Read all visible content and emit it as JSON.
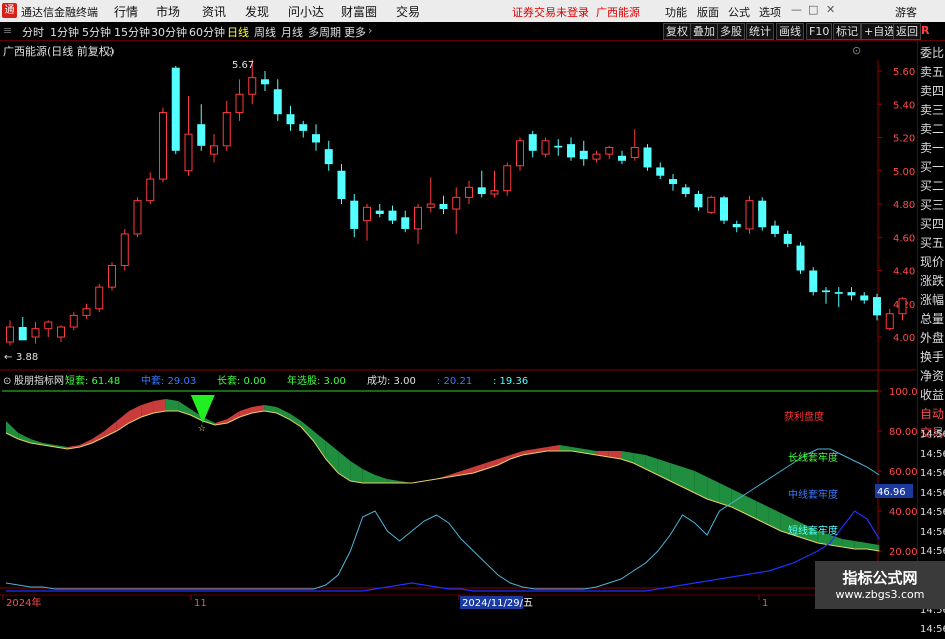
{
  "app": {
    "logo_glyph": "通",
    "title": "通达信金融终端"
  },
  "menu": [
    "行情",
    "市场",
    "资讯",
    "发现",
    "问小达",
    "财富圈",
    "交易"
  ],
  "notice": {
    "left": "证券交易未登录",
    "right": "广西能源"
  },
  "right_menu": [
    "功能",
    "版面",
    "公式",
    "选项",
    "游客"
  ],
  "periods": [
    {
      "label": "分时",
      "active": false
    },
    {
      "label": "1分钟",
      "active": false
    },
    {
      "label": "5分钟",
      "active": false
    },
    {
      "label": "15分钟",
      "active": false
    },
    {
      "label": "30分钟",
      "active": false
    },
    {
      "label": "60分钟",
      "active": false
    },
    {
      "label": "日线",
      "active": true
    },
    {
      "label": "周线",
      "active": false
    },
    {
      "label": "月线",
      "active": false
    },
    {
      "label": "多周期",
      "active": false
    },
    {
      "label": "更多",
      "active": false
    }
  ],
  "tools": [
    "复权",
    "叠加",
    "多股",
    "统计",
    "画线",
    "F10",
    "标记",
    "+自选",
    "返回"
  ],
  "sidebar": {
    "r_label": "R",
    "items": [
      "委比",
      "卖五",
      "卖四",
      "卖三",
      "卖二",
      "卖一",
      "买一",
      "买二",
      "买三",
      "买四",
      "买五",
      "现价",
      "涨跌",
      "涨幅",
      "总量",
      "外盘",
      "换手",
      "净资",
      "收益",
      "自动",
      "交易"
    ]
  },
  "colors": {
    "up": "#ff3b3b",
    "down": "#54ffff",
    "bg": "#000000",
    "grid": "#550000"
  },
  "main_chart": {
    "title": "广西能源(日线 前复权)",
    "high_label": "5.67",
    "low_label": "3.88",
    "ylim": [
      3.9,
      5.7
    ],
    "y_ticks": [
      "5.60",
      "5.40",
      "5.20",
      "5.00",
      "4.80",
      "4.60",
      "4.40",
      "4.20",
      "4.00"
    ]
  },
  "indicator": {
    "name": "股朋指标网",
    "items": [
      {
        "label": "短套:",
        "value": "61.48",
        "color": "#40ff40"
      },
      {
        "label": "中套:",
        "value": "29.03",
        "color": "#3a7bff"
      },
      {
        "label": "长套:",
        "value": "0.00",
        "color": "#40ff40"
      },
      {
        "label": "年选股:",
        "value": "3.00",
        "color": "#40ff40"
      },
      {
        "label": "成功:",
        "value": "3.00",
        "color": "#e0e0e0"
      },
      {
        "label": ":",
        "value": "20.21",
        "color": "#3a7bff"
      },
      {
        "label": ":",
        "value": "19.36",
        "color": "#54ffff"
      }
    ],
    "y_ticks": [
      "100.0",
      "80.00",
      "60.00",
      "40.00",
      "20.00"
    ],
    "current_value": "46.96",
    "annotations": {
      "profit": "获利盘度",
      "long": "长线套牢度",
      "mid": "中线套牢度",
      "short": "短线套牢度"
    },
    "right_times": [
      "14:56",
      "14:56",
      "14:56",
      "14:56",
      "14:56",
      "14:56",
      "14:56",
      "14:56",
      "14:56",
      "14:56",
      "14:56"
    ]
  },
  "x_axis": {
    "labels": [
      "2024年",
      "11",
      "2024/11/29/五",
      "1"
    ]
  },
  "watermark": {
    "line1": "指标公式网",
    "line2": "www.zbgs3.com"
  },
  "chart_data": {
    "type": "candlestick",
    "ohlc": [
      [
        3.97,
        4.1,
        3.95,
        4.06
      ],
      [
        4.06,
        4.12,
        4.02,
        3.98
      ],
      [
        4.0,
        4.09,
        3.96,
        4.05
      ],
      [
        4.05,
        4.1,
        4.0,
        4.09
      ],
      [
        4.0,
        4.07,
        3.97,
        4.06
      ],
      [
        4.06,
        4.15,
        4.04,
        4.13
      ],
      [
        4.13,
        4.2,
        4.11,
        4.17
      ],
      [
        4.17,
        4.32,
        4.15,
        4.3
      ],
      [
        4.3,
        4.45,
        4.28,
        4.43
      ],
      [
        4.43,
        4.65,
        4.4,
        4.62
      ],
      [
        4.62,
        4.84,
        4.6,
        4.82
      ],
      [
        4.82,
        4.99,
        4.8,
        4.95
      ],
      [
        4.95,
        5.38,
        4.93,
        5.35
      ],
      [
        5.62,
        5.63,
        5.1,
        5.12
      ],
      [
        5.0,
        5.45,
        4.97,
        5.22
      ],
      [
        5.28,
        5.4,
        5.12,
        5.15
      ],
      [
        5.1,
        5.22,
        5.05,
        5.15
      ],
      [
        5.15,
        5.42,
        5.12,
        5.35
      ],
      [
        5.35,
        5.55,
        5.3,
        5.46
      ],
      [
        5.46,
        5.67,
        5.4,
        5.56
      ],
      [
        5.55,
        5.6,
        5.48,
        5.52
      ],
      [
        5.49,
        5.55,
        5.3,
        5.34
      ],
      [
        5.34,
        5.39,
        5.24,
        5.28
      ],
      [
        5.28,
        5.3,
        5.2,
        5.24
      ],
      [
        5.22,
        5.28,
        5.12,
        5.17
      ],
      [
        5.13,
        5.18,
        5.0,
        5.04
      ],
      [
        5.0,
        5.04,
        4.8,
        4.83
      ],
      [
        4.82,
        4.86,
        4.6,
        4.65
      ],
      [
        4.7,
        4.8,
        4.58,
        4.78
      ],
      [
        4.76,
        4.8,
        4.72,
        4.74
      ],
      [
        4.76,
        4.79,
        4.68,
        4.7
      ],
      [
        4.72,
        4.76,
        4.63,
        4.65
      ],
      [
        4.65,
        4.8,
        4.56,
        4.78
      ],
      [
        4.78,
        4.96,
        4.75,
        4.8
      ],
      [
        4.8,
        4.85,
        4.74,
        4.77
      ],
      [
        4.77,
        4.9,
        4.62,
        4.84
      ],
      [
        4.84,
        4.94,
        4.8,
        4.9
      ],
      [
        4.9,
        5.0,
        4.84,
        4.86
      ],
      [
        4.86,
        5.0,
        4.84,
        4.88
      ],
      [
        4.88,
        5.05,
        4.85,
        5.03
      ],
      [
        5.03,
        5.2,
        5.0,
        5.18
      ],
      [
        5.22,
        5.24,
        5.08,
        5.12
      ],
      [
        5.1,
        5.2,
        5.08,
        5.18
      ],
      [
        5.15,
        5.19,
        5.09,
        5.14
      ],
      [
        5.16,
        5.2,
        5.06,
        5.08
      ],
      [
        5.12,
        5.18,
        5.03,
        5.07
      ],
      [
        5.07,
        5.12,
        5.05,
        5.1
      ],
      [
        5.1,
        5.15,
        5.07,
        5.14
      ],
      [
        5.09,
        5.12,
        5.04,
        5.06
      ],
      [
        5.08,
        5.25,
        5.06,
        5.14
      ],
      [
        5.14,
        5.16,
        5.0,
        5.02
      ],
      [
        5.02,
        5.05,
        4.95,
        4.97
      ],
      [
        4.95,
        4.98,
        4.88,
        4.92
      ],
      [
        4.9,
        4.92,
        4.84,
        4.86
      ],
      [
        4.86,
        4.88,
        4.76,
        4.78
      ],
      [
        4.75,
        4.85,
        4.74,
        4.84
      ],
      [
        4.84,
        4.85,
        4.68,
        4.7
      ],
      [
        4.68,
        4.7,
        4.63,
        4.66
      ],
      [
        4.65,
        4.85,
        4.62,
        4.82
      ],
      [
        4.82,
        4.84,
        4.64,
        4.66
      ],
      [
        4.67,
        4.7,
        4.6,
        4.62
      ],
      [
        4.62,
        4.64,
        4.54,
        4.56
      ],
      [
        4.55,
        4.57,
        4.38,
        4.4
      ],
      [
        4.4,
        4.42,
        4.25,
        4.27
      ],
      [
        4.28,
        4.3,
        4.2,
        4.27
      ],
      [
        4.27,
        4.3,
        4.18,
        4.26
      ],
      [
        4.27,
        4.3,
        4.22,
        4.25
      ],
      [
        4.25,
        4.27,
        4.2,
        4.22
      ],
      [
        4.24,
        4.26,
        4.1,
        4.13
      ],
      [
        4.05,
        4.17,
        4.04,
        4.14
      ],
      [
        4.14,
        4.24,
        4.1,
        4.23
      ]
    ],
    "indicator_series": {
      "upper": [
        85,
        79,
        76,
        74,
        73,
        72,
        73,
        76,
        80,
        85,
        90,
        93,
        95,
        96,
        95,
        91,
        87,
        84,
        86,
        90,
        92,
        93,
        92,
        89,
        85,
        80,
        75,
        70,
        65,
        61,
        58,
        56,
        55,
        54,
        55,
        56,
        58,
        60,
        62,
        64,
        66,
        68,
        70,
        71,
        72,
        73,
        72,
        71,
        70,
        70,
        70,
        69,
        68,
        66,
        64,
        62,
        60,
        57,
        54,
        51,
        48,
        45,
        42,
        39,
        36,
        33,
        30,
        28,
        26,
        25,
        24,
        23
      ],
      "lower": [
        79,
        76,
        74,
        73,
        72,
        71,
        72,
        74,
        77,
        80,
        84,
        87,
        89,
        90,
        90,
        88,
        85,
        83,
        84,
        87,
        89,
        90,
        89,
        86,
        82,
        75,
        66,
        59,
        55,
        54,
        54,
        54,
        54,
        54,
        55,
        56,
        57,
        58,
        59,
        61,
        63,
        66,
        68,
        69,
        70,
        70,
        70,
        69,
        68,
        67,
        66,
        64,
        61,
        58,
        55,
        52,
        49,
        46,
        44,
        42,
        39,
        36,
        33,
        30,
        28,
        26,
        24,
        23,
        22,
        21,
        21,
        20
      ],
      "short": [
        4,
        3,
        2,
        2,
        1,
        1,
        1,
        1,
        1,
        1,
        1,
        1,
        1,
        1,
        1,
        1,
        1,
        1,
        1,
        1,
        1,
        1,
        1,
        1,
        1,
        1,
        3,
        8,
        20,
        37,
        40,
        30,
        25,
        30,
        35,
        38,
        34,
        26,
        20,
        14,
        8,
        4,
        2,
        1,
        1,
        1,
        1,
        1,
        2,
        4,
        6,
        10,
        14,
        20,
        28,
        38,
        34,
        28,
        40,
        44,
        48,
        52,
        56,
        60,
        64,
        68,
        71,
        71,
        68,
        65,
        62,
        58
      ],
      "mid": [
        0,
        0,
        0,
        0,
        0,
        0,
        0,
        0,
        0,
        0,
        0,
        0,
        0,
        0,
        0,
        0,
        0,
        0,
        0,
        0,
        0,
        0,
        0,
        0,
        0,
        0,
        0,
        0,
        0,
        0,
        1,
        2,
        3,
        4,
        3,
        2,
        1,
        1,
        0,
        0,
        0,
        0,
        0,
        0,
        0,
        0,
        0,
        0,
        0,
        0,
        0,
        0,
        0,
        1,
        2,
        3,
        4,
        5,
        6,
        7,
        8,
        9,
        10,
        12,
        14,
        17,
        20,
        24,
        32,
        40,
        36,
        26
      ]
    }
  }
}
